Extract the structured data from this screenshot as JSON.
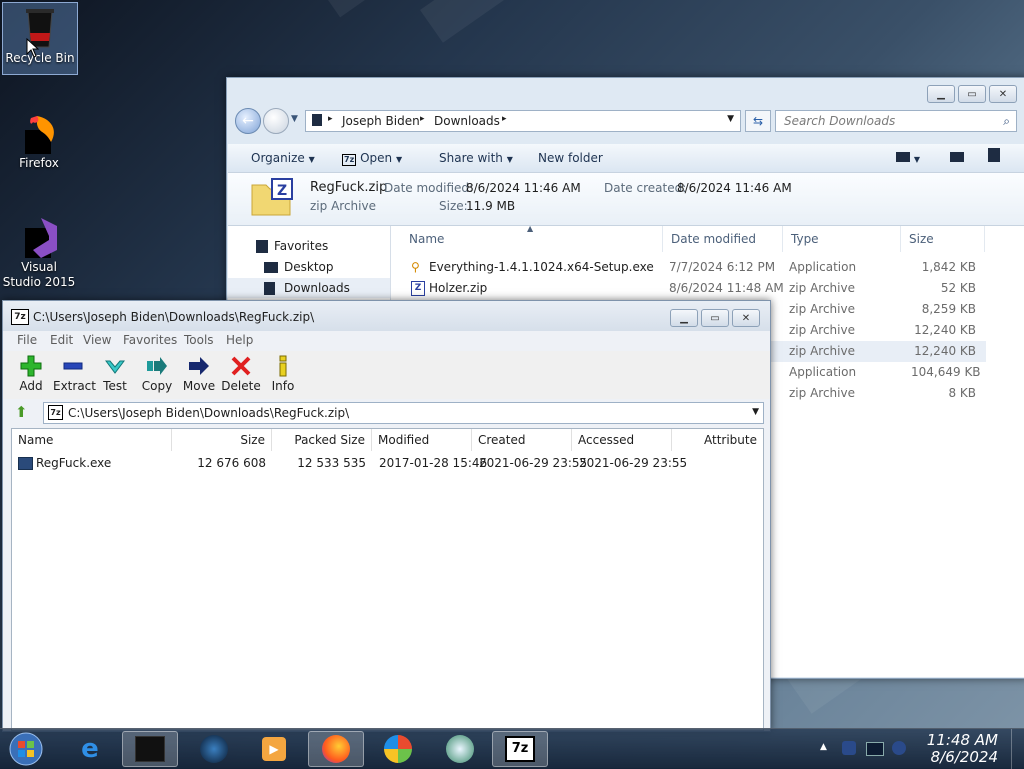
{
  "desktop": {
    "icons": [
      {
        "label": "Recycle Bin"
      },
      {
        "label": "Firefox"
      },
      {
        "label": "Visual Studio 2015"
      }
    ]
  },
  "explorer": {
    "breadcrumb": [
      "Joseph Biden",
      "Downloads"
    ],
    "search_placeholder": "Search Downloads",
    "toolbar": {
      "organize": "Organize",
      "open": "Open",
      "share_with": "Share with",
      "new_folder": "New folder"
    },
    "details": {
      "name": "RegFuck.zip",
      "type": "zip Archive",
      "date_modified_label": "Date modified:",
      "date_modified": "8/6/2024 11:46 AM",
      "date_created_label": "Date created:",
      "date_created": "8/6/2024 11:46 AM",
      "size_label": "Size:",
      "size": "11.9 MB"
    },
    "nav": {
      "favorites": "Favorites",
      "desktop": "Desktop",
      "downloads": "Downloads"
    },
    "columns": {
      "name": "Name",
      "date_modified": "Date modified",
      "type": "Type",
      "size": "Size"
    },
    "files": [
      {
        "name": "Everything-1.4.1.1024.x64-Setup.exe",
        "date": "7/7/2024 6:12 PM",
        "type": "Application",
        "size": "1,842 KB"
      },
      {
        "name": "Holzer.zip",
        "date": "8/6/2024 11:48 AM",
        "type": "zip Archive",
        "size": "52 KB"
      },
      {
        "name": "",
        "date": "",
        "type": "zip Archive",
        "size": "8,259 KB"
      },
      {
        "name": "",
        "date": "",
        "type": "zip Archive",
        "size": "12,240 KB"
      },
      {
        "name": "",
        "date": "",
        "type": "zip Archive",
        "size": "12,240 KB"
      },
      {
        "name": "",
        "date": "",
        "type": "Application",
        "size": "104,649 KB"
      },
      {
        "name": "",
        "date": "",
        "type": "zip Archive",
        "size": "8 KB"
      }
    ]
  },
  "sevenzip": {
    "title": "C:\\Users\\Joseph Biden\\Downloads\\RegFuck.zip\\",
    "menu": [
      "File",
      "Edit",
      "View",
      "Favorites",
      "Tools",
      "Help"
    ],
    "toolbar": [
      "Add",
      "Extract",
      "Test",
      "Copy",
      "Move",
      "Delete",
      "Info"
    ],
    "path": "C:\\Users\\Joseph Biden\\Downloads\\RegFuck.zip\\",
    "columns": [
      "Name",
      "Size",
      "Packed Size",
      "Modified",
      "Created",
      "Accessed",
      "Attribute"
    ],
    "rows": [
      {
        "name": "RegFuck.exe",
        "size": "12 676 608",
        "packed": "12 533 535",
        "modified": "2017-01-28 15:46",
        "created": "2021-06-29 23:55",
        "accessed": "2021-06-29 23:55"
      }
    ]
  },
  "taskbar": {
    "time": "11:48 AM",
    "date": "8/6/2024",
    "zip_label": "7z"
  },
  "colors": {
    "accent_blue": "#2a5fa8",
    "add_green": "#2db52d",
    "delete_red": "#e02020"
  }
}
